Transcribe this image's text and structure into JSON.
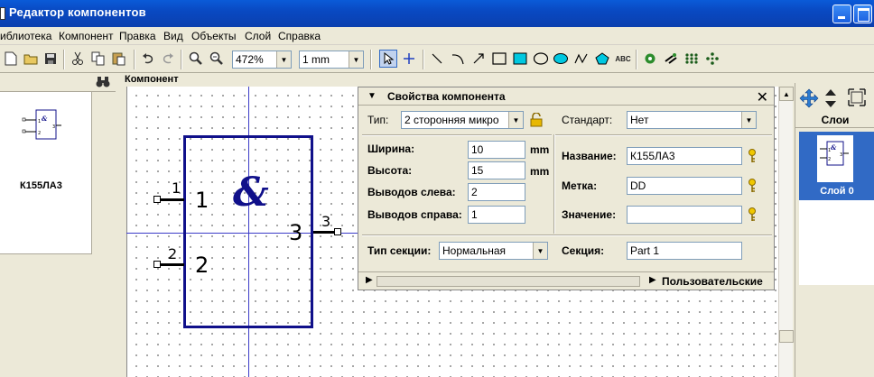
{
  "window": {
    "title": "Редактор компонентов"
  },
  "menu": [
    "иблиотека",
    "Компонент",
    "Правка",
    "Вид",
    "Объекты",
    "Слой",
    "Справка"
  ],
  "toolbar": {
    "zoom": "472%",
    "grid": "1 mm",
    "text_tool": "ABC"
  },
  "library": {
    "component_name": "К155ЛА3"
  },
  "canvas": {
    "header": "Компонент"
  },
  "component": {
    "symbol": "&",
    "pins": [
      {
        "number": "1",
        "name": "1"
      },
      {
        "number": "2",
        "name": "2"
      },
      {
        "number": "3",
        "name": "3"
      }
    ]
  },
  "properties": {
    "title": "Свойства компонента",
    "type_label": "Тип:",
    "type_value": "2 сторонняя микро",
    "standard_label": "Стандарт:",
    "standard_value": "Нет",
    "width_label": "Ширина:",
    "width_value": "10",
    "width_unit": "mm",
    "height_label": "Высота:",
    "height_value": "15",
    "height_unit": "mm",
    "pins_left_label": "Выводов слева:",
    "pins_left_value": "2",
    "pins_right_label": "Выводов справа:",
    "pins_right_value": "1",
    "name_label": "Название:",
    "name_value": "К155ЛА3",
    "tag_label": "Метка:",
    "tag_value": "DD",
    "value_label": "Значение:",
    "value_value": "",
    "section_type_label": "Тип секции:",
    "section_type_value": "Нормальная",
    "section_label": "Секция:",
    "section_value": "Part 1",
    "custom_label": "Пользовательские"
  },
  "layers": {
    "header": "Слои",
    "items": [
      "Слой 0"
    ]
  },
  "colors": {
    "titlebar": "#0a4fcc",
    "component_outline": "#10108a",
    "selection": "#316ac5"
  }
}
